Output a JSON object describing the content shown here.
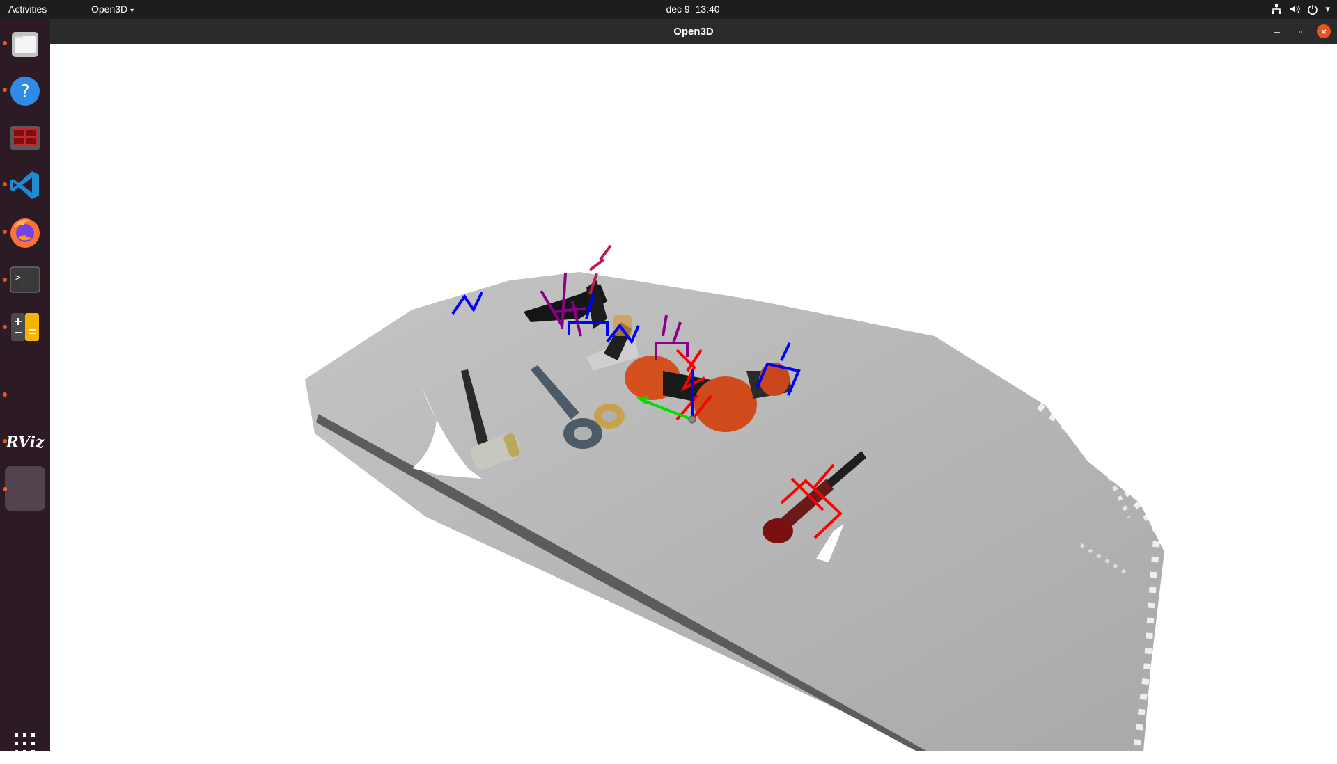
{
  "topbar": {
    "activities": "Activities",
    "app_menu": "Open3D",
    "clock": "dec 9  13:40",
    "arrow": "▾"
  },
  "dock": {
    "items": [
      {
        "name": "files",
        "icon": "folder-icon"
      },
      {
        "name": "help",
        "icon": "help-icon",
        "glyph": "?"
      },
      {
        "name": "remmina",
        "icon": "remote-desktop-icon"
      },
      {
        "name": "vscode",
        "icon": "vscode-icon"
      },
      {
        "name": "firefox",
        "icon": "firefox-icon"
      },
      {
        "name": "terminal",
        "icon": "terminal-icon",
        "glyph": ">_"
      },
      {
        "name": "calculator",
        "icon": "calculator-icon"
      },
      {
        "name": "rviz",
        "icon": "rviz-icon",
        "glyph": "RViz"
      },
      {
        "name": "open3d",
        "icon": "open3d-icon"
      }
    ],
    "apps_glyph": "⋮⋮⋮"
  },
  "window": {
    "title": "Open3D",
    "minimize": "–",
    "maximize": "▫",
    "close": "×"
  },
  "colors": {
    "topbar": "#1d1d1d",
    "dock": "#2c1a25",
    "titlebar": "#2b2b2b",
    "accent": "#e95420",
    "table": "#b4b4b4",
    "grasp_red": "#ff0000",
    "grasp_blue": "#0000ff",
    "grasp_purple": "#8b008b"
  }
}
